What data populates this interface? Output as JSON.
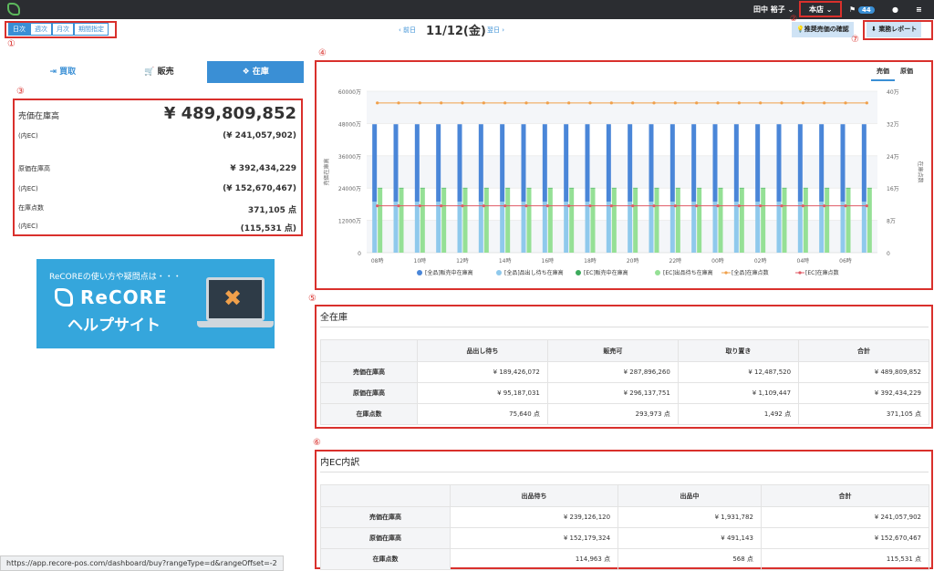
{
  "topbar": {
    "user": "田中 裕子",
    "store": "本店",
    "badge": "44"
  },
  "range_tabs": [
    {
      "label": "日次",
      "active": true
    },
    {
      "label": "週次",
      "active": false
    },
    {
      "label": "月次",
      "active": false
    },
    {
      "label": "期間指定",
      "active": false
    }
  ],
  "date": {
    "prev": "‹ 前日",
    "current": "11/12(金)",
    "next": "翌日 ›"
  },
  "actions": {
    "recommend": "推奨売価の確認",
    "report": "業務レポート"
  },
  "markers": [
    "①",
    "②",
    "③",
    "④",
    "⑤",
    "⑥",
    "⑦"
  ],
  "modes": [
    {
      "label": "買取",
      "icon": "sign-in-icon",
      "active": false
    },
    {
      "label": "販売",
      "icon": "cart-icon",
      "active": false
    },
    {
      "label": "在庫",
      "icon": "cubes-icon",
      "active": true
    }
  ],
  "summary": {
    "sale_label": "売価在庫高",
    "sale_value": "¥ 489,809,852",
    "sale_ec_label": "(内EC)",
    "sale_ec_value": "(¥ 241,057,902)",
    "cost_label": "原価在庫高",
    "cost_value": "¥ 392,434,229",
    "cost_ec_label": "(内EC)",
    "cost_ec_value": "(¥ 152,670,467)",
    "count_label": "在庫点数",
    "count_value": "371,105 点",
    "count_ec_label": "(内EC)",
    "count_ec_value": "(115,531 点)"
  },
  "banner": {
    "top": "ReCOREの使い方や疑問点は・・・",
    "brand": "ReCORE",
    "sub": "ヘルプサイト"
  },
  "chart_tabs": [
    {
      "label": "売価",
      "active": true
    },
    {
      "label": "原価",
      "active": false
    }
  ],
  "chart_data": {
    "type": "bar",
    "categories": [
      "08時",
      "09時",
      "10時",
      "11時",
      "12時",
      "13時",
      "14時",
      "15時",
      "16時",
      "17時",
      "18時",
      "19時",
      "20時",
      "21時",
      "22時",
      "23時",
      "00時",
      "01時",
      "02時",
      "03時",
      "04時",
      "05時",
      "06時",
      "07時"
    ],
    "x_tick_labels": [
      "08時",
      "10時",
      "12時",
      "14時",
      "16時",
      "18時",
      "20時",
      "22時",
      "00時",
      "02時",
      "04時",
      "06時"
    ],
    "ylabel": "売価在庫高",
    "y2label": "在庫点数",
    "ylim": [
      0,
      60000
    ],
    "y2lim": [
      0,
      40
    ],
    "y_ticks": [
      "0",
      "12000万",
      "24000万",
      "36000万",
      "48000万",
      "60000万"
    ],
    "y2_ticks": [
      "0",
      "8万",
      "16万",
      "24万",
      "32万",
      "40万"
    ],
    "series": [
      {
        "name": "[全品]販売中在庫高",
        "type": "bar",
        "stack": "all",
        "color": "#4a86d8",
        "values": [
          28789,
          28789,
          28789,
          28789,
          28789,
          28789,
          28789,
          28789,
          28789,
          28789,
          28789,
          28789,
          28789,
          28789,
          28789,
          28789,
          28789,
          28789,
          28789,
          28789,
          28789,
          28789,
          28789,
          28789
        ]
      },
      {
        "name": "[全品]品出し待ち在庫高",
        "type": "bar",
        "stack": "all",
        "color": "#8fc9ec",
        "values": [
          18943,
          18943,
          18943,
          18943,
          18943,
          18943,
          18943,
          18943,
          18943,
          18943,
          18943,
          18943,
          18943,
          18943,
          18943,
          18943,
          18943,
          18943,
          18943,
          18943,
          18943,
          18943,
          18943,
          18943
        ]
      },
      {
        "name": "[EC]販売中在庫高",
        "type": "bar",
        "stack": "ec",
        "color": "#3daa5c",
        "values": [
          193,
          193,
          193,
          193,
          193,
          193,
          193,
          193,
          193,
          193,
          193,
          193,
          193,
          193,
          193,
          193,
          193,
          193,
          193,
          193,
          193,
          193,
          193,
          193
        ]
      },
      {
        "name": "[EC]出品待ち在庫高",
        "type": "bar",
        "stack": "ec",
        "color": "#95e095",
        "values": [
          23913,
          23913,
          23913,
          23913,
          23913,
          23913,
          23913,
          23913,
          23913,
          23913,
          23913,
          23913,
          23913,
          23913,
          23913,
          23913,
          23913,
          23913,
          23913,
          23913,
          23913,
          23913,
          23913,
          23913
        ]
      },
      {
        "name": "[全品]在庫点数",
        "type": "line",
        "axis": "right",
        "color": "#f0a04b",
        "values": [
          37.1,
          37.1,
          37.1,
          37.1,
          37.1,
          37.1,
          37.1,
          37.1,
          37.1,
          37.1,
          37.1,
          37.1,
          37.1,
          37.1,
          37.1,
          37.1,
          37.1,
          37.1,
          37.1,
          37.1,
          37.1,
          37.1,
          37.1,
          37.1
        ]
      },
      {
        "name": "[EC]在庫点数",
        "type": "line",
        "axis": "right",
        "color": "#e05a64",
        "values": [
          11.6,
          11.6,
          11.6,
          11.6,
          11.6,
          11.6,
          11.6,
          11.6,
          11.6,
          11.6,
          11.6,
          11.6,
          11.6,
          11.6,
          11.6,
          11.6,
          11.6,
          11.6,
          11.6,
          11.6,
          11.6,
          11.6,
          11.6,
          11.6
        ]
      }
    ],
    "legend_position": "bottom"
  },
  "all_stock": {
    "title": "全在庫",
    "columns": [
      "品出し待ち",
      "販売可",
      "取り置き",
      "合計"
    ],
    "rows": [
      {
        "label": "売価在庫高",
        "cells": [
          "¥ 189,426,072",
          "¥ 287,896,260",
          "¥ 12,487,520",
          "¥ 489,809,852"
        ]
      },
      {
        "label": "原価在庫高",
        "cells": [
          "¥ 95,187,031",
          "¥ 296,137,751",
          "¥ 1,109,447",
          "¥ 392,434,229"
        ]
      },
      {
        "label": "在庫点数",
        "cells": [
          "75,640 点",
          "293,973 点",
          "1,492 点",
          "371,105 点"
        ]
      }
    ]
  },
  "ec_stock": {
    "title": "内EC内訳",
    "columns": [
      "出品待ち",
      "出品中",
      "合計"
    ],
    "rows": [
      {
        "label": "売価在庫高",
        "cells": [
          "¥ 239,126,120",
          "¥ 1,931,782",
          "¥ 241,057,902"
        ]
      },
      {
        "label": "原価在庫高",
        "cells": [
          "¥ 152,179,324",
          "¥ 491,143",
          "¥ 152,670,467"
        ]
      },
      {
        "label": "在庫点数",
        "cells": [
          "114,963 点",
          "568 点",
          "115,531 点"
        ]
      }
    ]
  },
  "status_url": "https://app.recore-pos.com/dashboard/buy?rangeType=d&rangeOffset=-2"
}
